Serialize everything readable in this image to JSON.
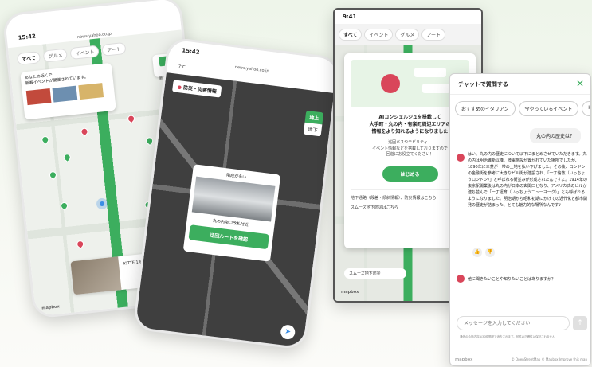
{
  "phone1": {
    "time": "15:42",
    "url": "news.yahoo.co.jp",
    "tabs": [
      "すべて",
      "グルメ",
      "イベント",
      "アート"
    ],
    "popup_text": "あなたの近くで\n新着イベントが開催されています。",
    "button_label": "散策する",
    "card_title": "KITTE 1階",
    "footer": "mapbox"
  },
  "phone2": {
    "time": "15:42",
    "url": "news.yahoo.co.jp",
    "temp": "7℃",
    "title": "防災・災害情報",
    "level_top": "地上",
    "level_bottom": "地下",
    "popup_title": "階段が多い",
    "popup_caption": "丸の内南口改札付近",
    "popup_button": "迂回ルートを確認"
  },
  "phone3": {
    "time": "9:41",
    "tabs": [
      "すべて",
      "イベント",
      "グルメ",
      "アート"
    ],
    "heading": "AIコンシェルジュを搭載して\n大手町・丸の内・有楽町周辺エリアの\n情報をより知れるようになりました",
    "body": "巡回バスやモビリティ、\nイベント情報などを搭載しておりますので\n回遊にお役立てください！",
    "start_button": "はじめる",
    "link1": "地下通路（段差・傾斜情報）、防災情報はこちら",
    "link2": "スムーズ地下防災はこちら",
    "bottom_label": "スムーズ地下防災",
    "footer": "mapbox"
  },
  "chat": {
    "header": "チャットで質問する",
    "chips": [
      "おすすめのイタリアン",
      "今やっているイベント",
      "KITTE"
    ],
    "user_message": "丸の内の歴史は？",
    "bot_message": "はい、丸の内の歴史について以下にまとめさせていただきます。丸の内は明治維新以降、陸軍施設が置かれていた場所でしたが、1890年に三菱が一帯の土地を払い下げました。その後、ロンドンの金融街を参考に大きなビル街が建設され、「一丁倫敦（いっちょうロンドン）」と呼ばれる街並みが形成されたんですよ。1914年の東京駅開業後は丸の内が日本の玄関口となり、アメリカ式のビルが建ち並んで「一丁紐育（いっちょうニューヨーク）」とも呼ばれるようになりました。明治期から昭和初期にかけての近代化と都市開発の歴史が詰まった、とても魅力的な場所なんです♪",
    "bot_question": "他に聞きたいことや知りたいことはありますか？",
    "input_placeholder": "メッセージを入力してください",
    "disclaimer": "通信の会話内容は30時間程で消去されます。回答の正確性は保証されません",
    "footer_left": "mapbox",
    "footer_right": "© OpenStreetMap  © Mapbox  Improve this map"
  },
  "colors": {
    "accent": "#3cae5e",
    "pin_red": "#d9465a",
    "pin_orange": "#f07a2b",
    "pin_yellow": "#e2b62c"
  }
}
